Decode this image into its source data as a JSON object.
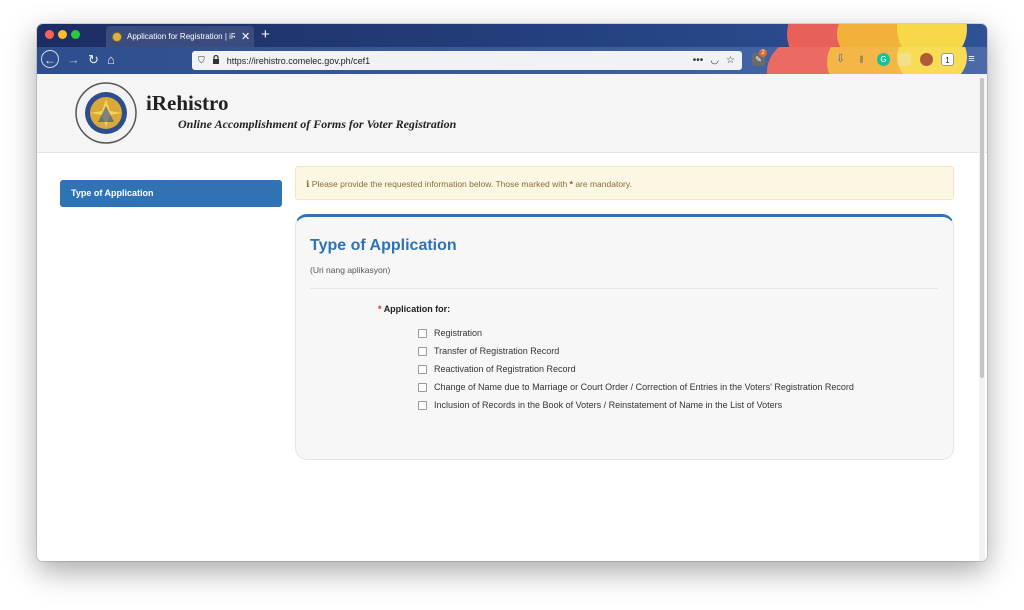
{
  "browser": {
    "tab_title": "Application for Registration | iR",
    "url": "https://irehistro.comelec.gov.ph/cef1",
    "url_more": "•••",
    "new_tab": "+",
    "tab_close": "✕"
  },
  "header": {
    "site_title": "iRehistro",
    "site_subtitle": "Online Accomplishment of Forms for Voter Registration",
    "seal_text_top": "COMMISSION ON ELECTIONS",
    "seal_text_bottom": "REPUBLIC OF THE PHILIPPINES"
  },
  "sidebar": {
    "items": [
      {
        "label": "Type of Application",
        "active": true
      }
    ]
  },
  "alert": {
    "before": "Please provide the requested information below. Those marked with",
    "marker": "*",
    "after": "are mandatory."
  },
  "form": {
    "title": "Type of Application",
    "subtitle": "(Uri nang aplikasyon)",
    "field_label": "Application for:",
    "required_marker": "*",
    "options": [
      "Registration",
      "Transfer of Registration Record",
      "Reactivation of Registration Record",
      "Change of Name due to Marriage or Court Order / Correction of Entries in the Voters' Registration Record",
      "Inclusion of Records in the Book of Voters / Reinstatement of Name in the List of Voters"
    ]
  },
  "colors": {
    "accent": "#2f73b5",
    "alert_bg": "#fcf7e3",
    "alert_text": "#8a6d3b",
    "required": "#c9302c"
  },
  "icons": {
    "info": "info-circle-icon",
    "shield": "shield-icon",
    "lock": "lock-icon",
    "pocket": "pocket-icon",
    "star": "bookmark-star-icon",
    "menu": "hamburger-menu-icon"
  },
  "extensions": {
    "badge_count": "1",
    "pin_badge": "2"
  }
}
